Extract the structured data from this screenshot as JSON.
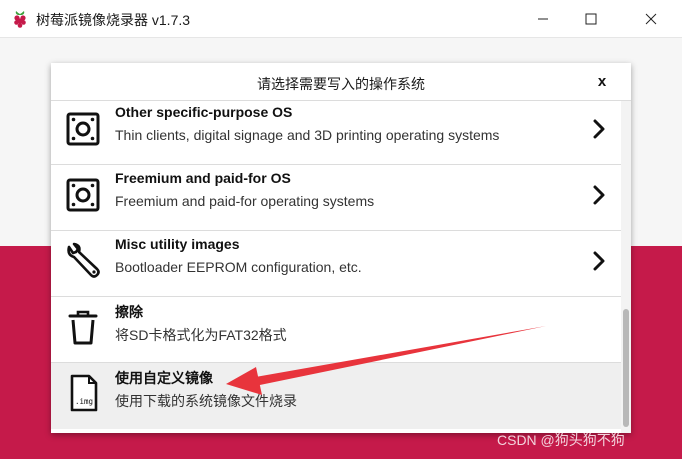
{
  "window": {
    "title": "树莓派镜像烧录器 v1.7.3",
    "icon": "raspberry-icon",
    "buttons": [
      "minimize-icon",
      "maximize-icon",
      "close-icon"
    ]
  },
  "colors": {
    "accent": "#c51a4a",
    "annotation_arrow": "#e8343c"
  },
  "modal": {
    "title": "请选择需要写入的操作系统",
    "close_label": "x",
    "items": [
      {
        "name": "Other specific-purpose OS",
        "description": "Thin clients, digital signage and 3D printing operating systems",
        "icon": "board-icon",
        "has_submenu": true
      },
      {
        "name": "Freemium and paid-for OS",
        "description": "Freemium and paid-for operating systems",
        "icon": "board-icon",
        "has_submenu": true
      },
      {
        "name": "Misc utility images",
        "description": "Bootloader EEPROM configuration, etc.",
        "icon": "wrench-icon",
        "has_submenu": true
      },
      {
        "name": "擦除",
        "description": "将SD卡格式化为FAT32格式",
        "icon": "trash-icon",
        "has_submenu": false
      },
      {
        "name": "使用自定义镜像",
        "description": "使用下载的系统镜像文件烧录",
        "icon": "img-file-icon",
        "icon_text": ".img",
        "has_submenu": false,
        "highlighted": true
      }
    ]
  },
  "watermark": "CSDN @狗头狗不狗"
}
